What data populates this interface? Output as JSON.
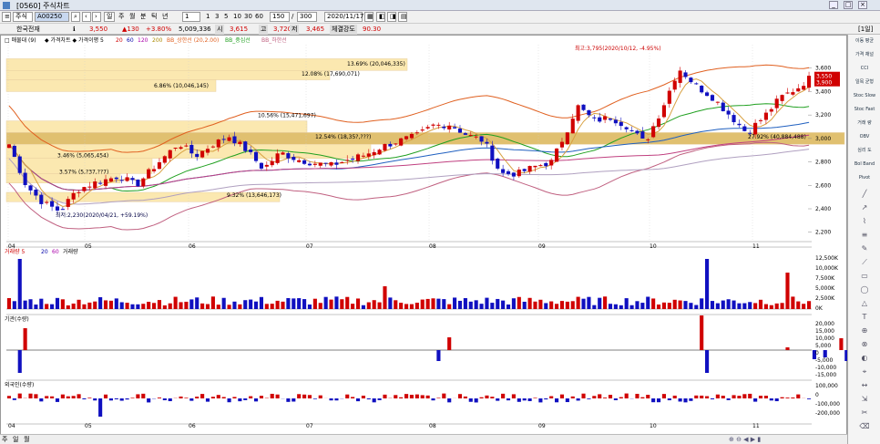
{
  "window": {
    "title": "[0560] 주식차트"
  },
  "toolbar": {
    "market": "주식",
    "code": "A00250",
    "period_buttons": [
      "주",
      "월",
      "분",
      "틱",
      "년"
    ],
    "minute_options": [
      "1",
      "3",
      "5",
      "10",
      "30",
      "60"
    ],
    "view_count": "150",
    "total_count": "300",
    "date": "2020/11/17"
  },
  "quote": {
    "name": "한국전재",
    "price": "3,550",
    "change": "▲130",
    "change_pct": "+3.80%",
    "volume": "5,009,336",
    "open_label": "시",
    "open": "3,615",
    "high_label": "고",
    "high": "3,720",
    "low_label": "저",
    "low": "3,465",
    "strength_label": "체결강도",
    "strength": "90.30",
    "period_tag": "[1일]"
  },
  "legend": {
    "price": "◆ 가격차트 ◆ 가격이평 5",
    "ma20": "20",
    "ma60": "60",
    "ma120": "120",
    "ma200": "200",
    "bb_upper": "BB_상한선 (20,2.00)",
    "bb_mid": "BB_중심선",
    "bb_lower": "BB_하한선",
    "head": "□ 매물대 (9)"
  },
  "annotations": {
    "high": "최고:3,795(2020/10/12, -4.95%)",
    "low": "최저:2,230(2020/04/21, +59.19%)"
  },
  "volume_profile": [
    {
      "label": "13.69% (20,046,335)"
    },
    {
      "label": "12.08% (17,690,071)"
    },
    {
      "label": "6.86% (10,046,145)"
    },
    {
      "label": "10.56% (15,471,697)"
    },
    {
      "label": "12.54% (18,35?,???)"
    },
    {
      "label": "27.92% (40,884,488)"
    },
    {
      "label": "3.46% (5,065,454)"
    },
    {
      "label": "3.57% (5,?37,??7)"
    },
    {
      "label": "9.32% (13,646,173)"
    }
  ],
  "x_months": [
    "04",
    "05",
    "06",
    "07",
    "08",
    "09",
    "10",
    "11"
  ],
  "price_axis": [
    "3,600",
    "3,400",
    "3,200",
    "3,000",
    "2,800",
    "2,600",
    "2,400",
    "2,200"
  ],
  "current_price_tag": "3,550",
  "current_price_tag2": "3,900",
  "vol_panel": {
    "title": "거래량 5",
    "title2": "20",
    "title3": "60",
    "title4": "거래량",
    "axis": [
      "12,500K",
      "10,000K",
      "7,500K",
      "5,000K",
      "2,500K",
      "0K"
    ]
  },
  "inst_panel": {
    "title": "기관(수량)",
    "axis": [
      "20,000",
      "15,000",
      "10,000",
      "5,000",
      "0",
      "-5,000",
      "-10,000",
      "-15,000"
    ]
  },
  "foreign_panel": {
    "title": "외국인(수량)",
    "axis": [
      "100,000",
      "0",
      "-100,000",
      "-200,000"
    ]
  },
  "right_tools": [
    "이동 평균",
    "가격 채널",
    "CCI",
    "일목 균형",
    "Stoc Slow",
    "Stoc Fast",
    "거래 량",
    "OBV",
    "심리 도",
    "Bol Band",
    "Pivot"
  ],
  "bottom_tabs": [
    "주",
    "일",
    "월"
  ],
  "colors": {
    "up": "#d00000",
    "down": "#1010c0",
    "bb_upper": "#e06020",
    "ma20": "#20a020",
    "ma60": "#2060c0",
    "ma120": "#c04080"
  }
}
